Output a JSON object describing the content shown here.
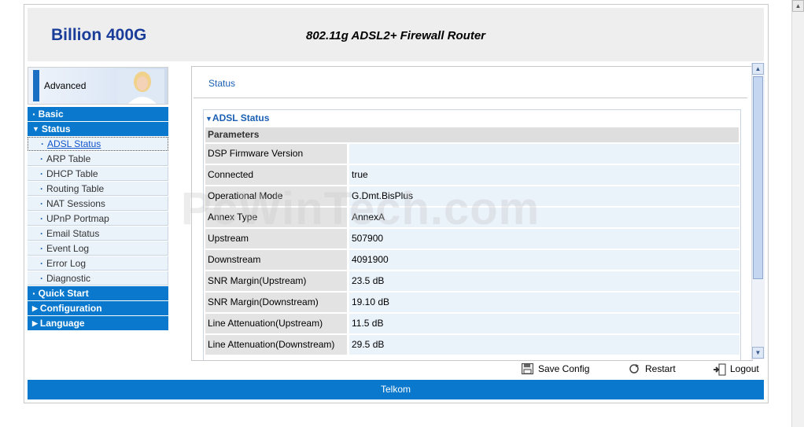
{
  "header": {
    "brand": "Billion 400G",
    "model": "802.11g ADSL2+ Firewall Router"
  },
  "sidebar": {
    "card_label": "Advanced",
    "items": [
      {
        "label": "Basic",
        "type": "main",
        "marker": "bullet"
      },
      {
        "label": "Status",
        "type": "main",
        "marker": "expanded"
      },
      {
        "label": "ADSL Status",
        "type": "sub",
        "active": true
      },
      {
        "label": "ARP Table",
        "type": "sub"
      },
      {
        "label": "DHCP Table",
        "type": "sub"
      },
      {
        "label": "Routing Table",
        "type": "sub"
      },
      {
        "label": "NAT Sessions",
        "type": "sub"
      },
      {
        "label": "UPnP Portmap",
        "type": "sub"
      },
      {
        "label": "Email Status",
        "type": "sub"
      },
      {
        "label": "Event Log",
        "type": "sub"
      },
      {
        "label": "Error Log",
        "type": "sub"
      },
      {
        "label": "Diagnostic",
        "type": "sub"
      },
      {
        "label": "Quick Start",
        "type": "main",
        "marker": "bullet"
      },
      {
        "label": "Configuration",
        "type": "main",
        "marker": "collapsed"
      },
      {
        "label": "Language",
        "type": "main",
        "marker": "collapsed"
      }
    ]
  },
  "content": {
    "section_title": "Status",
    "panel_title": "ADSL Status",
    "params_header": "Parameters",
    "rows": [
      {
        "key": "DSP Firmware Version",
        "value": ""
      },
      {
        "key": "Connected",
        "value": "true"
      },
      {
        "key": "Operational Mode",
        "value": "G.Dmt.BisPlus"
      },
      {
        "key": "Annex Type",
        "value": "AnnexA"
      },
      {
        "key": "Upstream",
        "value": "507900"
      },
      {
        "key": "Downstream",
        "value": "4091900"
      },
      {
        "key": "SNR Margin(Upstream)",
        "value": "23.5 dB"
      },
      {
        "key": "SNR Margin(Downstream)",
        "value": "19.10 dB"
      },
      {
        "key": "Line Attenuation(Upstream)",
        "value": "11.5 dB"
      },
      {
        "key": "Line Attenuation(Downstream)",
        "value": "29.5 dB"
      }
    ]
  },
  "actions": {
    "save_label": "Save Config",
    "restart_label": "Restart",
    "logout_label": "Logout"
  },
  "footer": {
    "text": "Telkom"
  },
  "watermark": "PcWinTech.com",
  "colors": {
    "accent_blue": "#0a78cc",
    "brand_blue": "#1a3d99",
    "link_blue": "#1a5fb4"
  }
}
